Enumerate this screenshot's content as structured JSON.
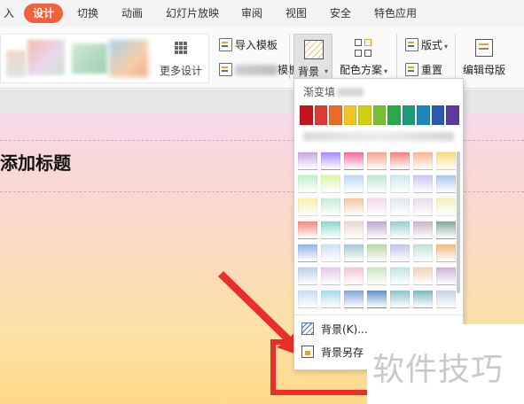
{
  "tabs": [
    {
      "label": "入"
    },
    {
      "label": "设计",
      "active": true
    },
    {
      "label": "切换"
    },
    {
      "label": "动画"
    },
    {
      "label": "幻灯片放映"
    },
    {
      "label": "审阅"
    },
    {
      "label": "视图"
    },
    {
      "label": "安全"
    },
    {
      "label": "特色应用"
    }
  ],
  "ribbon": {
    "more_designs_label": "更多设计",
    "import_template_label": "导入模板",
    "template_label_suffix": "模板",
    "background_label": "背景",
    "color_scheme_label": "配色方案",
    "layout_label": "版式",
    "reset_label": "重置",
    "edit_master_label": "编辑母版"
  },
  "slide": {
    "title": "添加标题"
  },
  "dropdown": {
    "section_label": "渐变填",
    "solid_colors": [
      "#c3161c",
      "#e03a36",
      "#ea6b26",
      "#f2c322",
      "#cfcf16",
      "#7cbd36",
      "#2aa84a",
      "#1e9a7a",
      "#1e86b8",
      "#2b5bb0",
      "#5c3a9e"
    ],
    "gradients": [
      [
        "#c7a7de",
        "#a78bff",
        "#f06aa2",
        "#f6a28d",
        "#f0827c",
        "#f8b58c",
        "#f6d97a"
      ],
      [
        "#bff0c8",
        "#d9f5a6",
        "#b9d8f5",
        "#bfe6d0",
        "#c9e9ee",
        "#c8c6f3",
        "#a9c6ee"
      ],
      [
        "#f6f0a8",
        "#c6ebd3",
        "#f4c6a0",
        "#f0d8e6",
        "#e0e7ee",
        "#e6dcea",
        "#f5f0c0"
      ],
      [
        "#ef8b7f",
        "#8dd8cc",
        "#e9d8cf",
        "#b9a6cf",
        "#9bcdd0",
        "#c8b5c8",
        "#7fa89e"
      ],
      [
        "#8fb3e8",
        "#cfe0f0",
        "#a6c9d6",
        "#b9d6a8",
        "#c2c4e8",
        "#c1e0d6",
        "#f0b87f"
      ],
      [
        "#bcd0ec",
        "#e6c9e4",
        "#f1c5d2",
        "#c7e6bf",
        "#bde5df",
        "#f3d1b5",
        "#c9b3d6"
      ],
      [
        "#c9dcec",
        "#a8d8e8",
        "#7fa6d1",
        "#5f8fc8",
        "#8fc4cf",
        "#7fb7c2",
        "#c4d2e6"
      ]
    ],
    "background_item_label": "背景(K)...",
    "save_background_label": "背景另存"
  },
  "watermark": {
    "text": "软件技巧"
  }
}
